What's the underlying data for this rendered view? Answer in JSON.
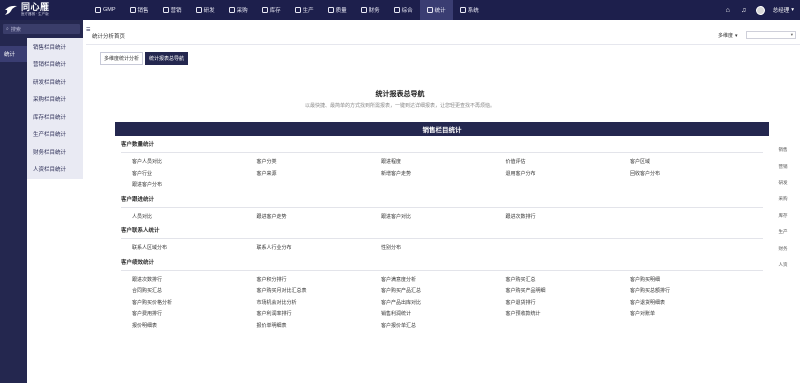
{
  "brand": {
    "name": "同心雁",
    "slogan": "医疗器械 · 生产版"
  },
  "nav": [
    {
      "label": "GMP",
      "icon": "gmp-icon",
      "active": false
    },
    {
      "label": "销售",
      "icon": "sales-icon",
      "active": false
    },
    {
      "label": "营销",
      "icon": "marketing-icon",
      "active": false
    },
    {
      "label": "研发",
      "icon": "rnd-icon",
      "active": false
    },
    {
      "label": "采购",
      "icon": "purchase-icon",
      "active": false
    },
    {
      "label": "库存",
      "icon": "inventory-icon",
      "active": false
    },
    {
      "label": "生产",
      "icon": "production-icon",
      "active": false
    },
    {
      "label": "质量",
      "icon": "quality-icon",
      "active": false
    },
    {
      "label": "财务",
      "icon": "finance-icon",
      "active": false
    },
    {
      "label": "综合",
      "icon": "general-icon",
      "active": false
    },
    {
      "label": "统计",
      "icon": "stats-icon",
      "active": true
    },
    {
      "label": "系统",
      "icon": "system-icon",
      "active": false
    }
  ],
  "topright": {
    "user": "总经理"
  },
  "search": {
    "placeholder": "搜索"
  },
  "sidebar_module": "统计",
  "sidebar_items": [
    "销售栏目统计",
    "营销栏目统计",
    "研发栏目统计",
    "采购栏目统计",
    "库存栏目统计",
    "生产栏目统计",
    "财务栏目统计",
    "人资栏目统计"
  ],
  "breadcrumb": "统计分析首页",
  "range": {
    "label": "多维度"
  },
  "subtabs": [
    "多维度统计分析",
    "统计报表总导航"
  ],
  "page": {
    "title": "统计报表总导航",
    "subtitle": "以最快捷、最简单的方式找到所需报表，一键到达详细报表，让您轻更查找不再烦恼。"
  },
  "card": {
    "title": "销售栏目统计"
  },
  "sections": [
    {
      "title": "客户数量统计",
      "links": [
        "客户人员对比",
        "客户分类",
        "跟进程度",
        "价值评估",
        "客户区域",
        "客户行业",
        "客户来源",
        "新增客户走势",
        "退用客户分布",
        "回收客户分布",
        "跟进客户分布"
      ]
    },
    {
      "title": "客户跟进统计",
      "links": [
        "人员对比",
        "跟进客户走势",
        "跟进客户对比",
        "跟进次数排行"
      ]
    },
    {
      "title": "客户联系人统计",
      "links": [
        "联系人区域分布",
        "联系人行业分布",
        "性别分布"
      ]
    },
    {
      "title": "客户绩效统计",
      "links": [
        "跟进次数排行",
        "客户积分排行",
        "客户满意度分析",
        "客户购买汇总",
        "客户购买明细",
        "合同购买汇总",
        "客户购买月对比汇总表",
        "客户购买产品汇总",
        "客户购买产品明细",
        "客户购买总额排行",
        "客户购买价格分析",
        "市场机会对比分析",
        "客户产品出库对比",
        "客户退货排行",
        "客户退货明细表",
        "客户费用排行",
        "客户利润率排行",
        "销售利润统计",
        "客户预收款统计",
        "客户对账单",
        "报价明细表",
        "报价单明细表",
        "客户报价单汇总"
      ]
    }
  ],
  "anchors": [
    "销售",
    "营销",
    "研发",
    "采购",
    "库存",
    "生产",
    "财务",
    "人资"
  ],
  "colors": {
    "primary": "#1d1f4c",
    "sidebar": "#24274f",
    "accent": "#3a3d72"
  }
}
